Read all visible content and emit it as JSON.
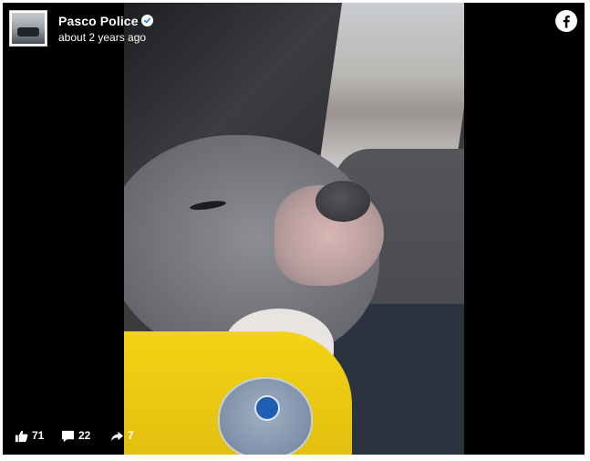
{
  "post": {
    "page_name": "Pasco Police",
    "timestamp": "about 2 years ago",
    "verified": true
  },
  "stats": {
    "likes": "71",
    "comments": "22",
    "shares": "7"
  },
  "icons": {
    "brand": "facebook-logo-icon",
    "like": "thumbs-up-icon",
    "comment": "comment-icon",
    "share": "share-arrow-icon",
    "verified": "verified-badge-icon"
  },
  "colors": {
    "background": "#000000",
    "text": "#ffffff",
    "verified_blue": "#1877f2"
  }
}
